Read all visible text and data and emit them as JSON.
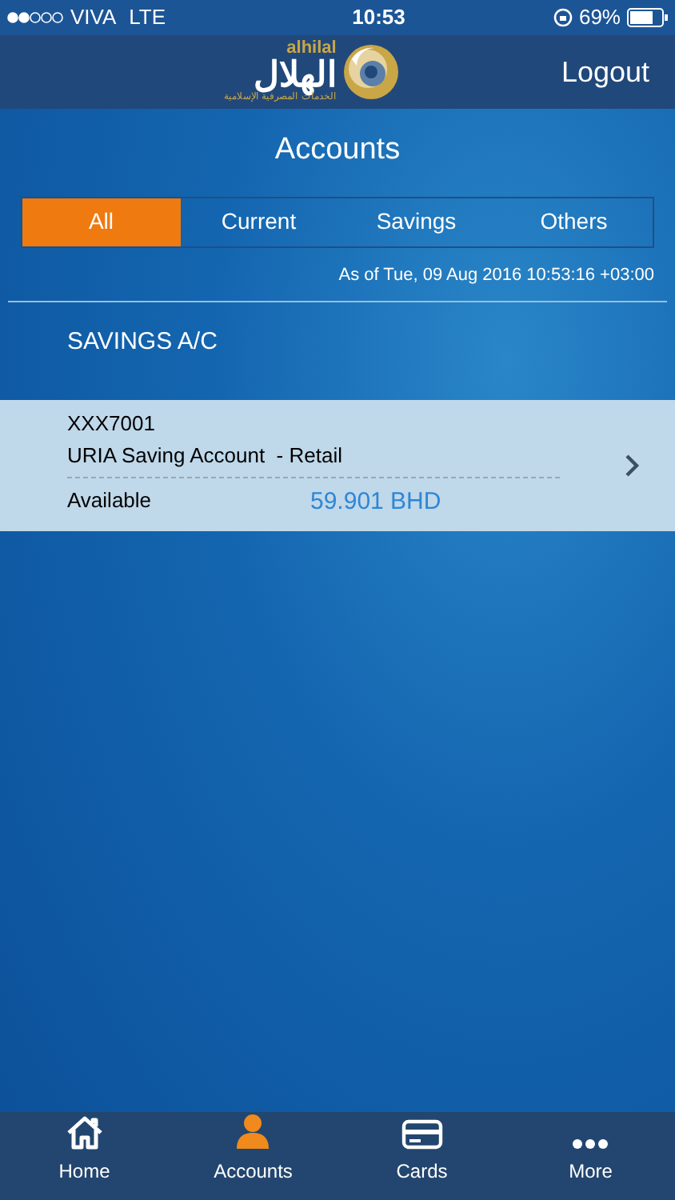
{
  "status_bar": {
    "carrier": "VIVA",
    "network": "LTE",
    "time": "10:53",
    "battery": "69%"
  },
  "header": {
    "logo_latin": "alhilal",
    "logo_arabic": "الهلال",
    "logo_tagline": "الخدمات المصرفية الإسلامية",
    "logout": "Logout"
  },
  "title": "Accounts",
  "tabs": [
    {
      "label": "All",
      "selected": true
    },
    {
      "label": "Current",
      "selected": false
    },
    {
      "label": "Savings",
      "selected": false
    },
    {
      "label": "Others",
      "selected": false
    }
  ],
  "as_of": "As of Tue, 09 Aug 2016 10:53:16 +03:00",
  "section": "SAVINGS A/C",
  "accounts": [
    {
      "number": "XXX7001",
      "name": "URIA Saving Account  - Retail",
      "balance_label": "Available",
      "balance": "59.901 BHD"
    }
  ],
  "bottom_nav": [
    {
      "label": "Home",
      "kind": "home",
      "selected": false
    },
    {
      "label": "Accounts",
      "kind": "person",
      "selected": true
    },
    {
      "label": "Cards",
      "kind": "card",
      "selected": false
    },
    {
      "label": "More",
      "kind": "more",
      "selected": false
    }
  ]
}
